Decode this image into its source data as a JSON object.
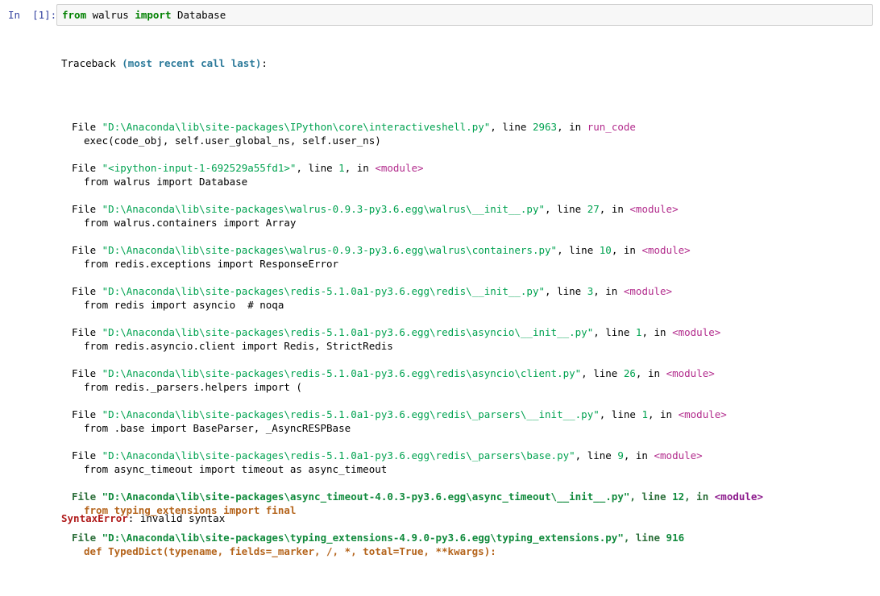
{
  "cell": {
    "prompt": "In  [1]:",
    "input": {
      "kw1": "from",
      "mod": " walrus ",
      "kw2": "import",
      "name": " Database"
    }
  },
  "traceback": {
    "header_label": "Traceback ",
    "header_paren": "(most recent call last)",
    "header_colon": ":",
    "frames": [
      {
        "file_kw": "File ",
        "path": "\"D:\\Anaconda\\lib\\site-packages\\IPython\\core\\interactiveshell.py\"",
        "line_kw": ", line ",
        "line_no": "2963",
        "in_kw": ", in ",
        "func": "run_code",
        "code": "exec(code_obj, self.user_global_ns, self.user_ns)"
      },
      {
        "file_kw": "File ",
        "path": "\"<ipython-input-1-692529a55fd1>\"",
        "line_kw": ", line ",
        "line_no": "1",
        "in_kw": ", in ",
        "func": "<module>",
        "code": "from walrus import Database"
      },
      {
        "file_kw": "File ",
        "path": "\"D:\\Anaconda\\lib\\site-packages\\walrus-0.9.3-py3.6.egg\\walrus\\__init__.py\"",
        "line_kw": ", line ",
        "line_no": "27",
        "in_kw": ", in ",
        "func": "<module>",
        "code": "from walrus.containers import Array"
      },
      {
        "file_kw": "File ",
        "path": "\"D:\\Anaconda\\lib\\site-packages\\walrus-0.9.3-py3.6.egg\\walrus\\containers.py\"",
        "line_kw": ", line ",
        "line_no": "10",
        "in_kw": ", in ",
        "func": "<module>",
        "code": "from redis.exceptions import ResponseError"
      },
      {
        "file_kw": "File ",
        "path": "\"D:\\Anaconda\\lib\\site-packages\\redis-5.1.0a1-py3.6.egg\\redis\\__init__.py\"",
        "line_kw": ", line ",
        "line_no": "3",
        "in_kw": ", in ",
        "func": "<module>",
        "code": "from redis import asyncio  # noqa"
      },
      {
        "file_kw": "File ",
        "path": "\"D:\\Anaconda\\lib\\site-packages\\redis-5.1.0a1-py3.6.egg\\redis\\asyncio\\__init__.py\"",
        "line_kw": ", line ",
        "line_no": "1",
        "in_kw": ", in ",
        "func": "<module>",
        "code": "from redis.asyncio.client import Redis, StrictRedis"
      },
      {
        "file_kw": "File ",
        "path": "\"D:\\Anaconda\\lib\\site-packages\\redis-5.1.0a1-py3.6.egg\\redis\\asyncio\\client.py\"",
        "line_kw": ", line ",
        "line_no": "26",
        "in_kw": ", in ",
        "func": "<module>",
        "code": "from redis._parsers.helpers import ("
      },
      {
        "file_kw": "File ",
        "path": "\"D:\\Anaconda\\lib\\site-packages\\redis-5.1.0a1-py3.6.egg\\redis\\_parsers\\__init__.py\"",
        "line_kw": ", line ",
        "line_no": "1",
        "in_kw": ", in ",
        "func": "<module>",
        "code": "from .base import BaseParser, _AsyncRESPBase"
      },
      {
        "file_kw": "File ",
        "path": "\"D:\\Anaconda\\lib\\site-packages\\redis-5.1.0a1-py3.6.egg\\redis\\_parsers\\base.py\"",
        "line_kw": ", line ",
        "line_no": "9",
        "in_kw": ", in ",
        "func": "<module>",
        "code": "from async_timeout import timeout as async_timeout"
      }
    ],
    "bold_frames": [
      {
        "file_kw": "File ",
        "path": "\"D:\\Anaconda\\lib\\site-packages\\async_timeout-4.0.3-py3.6.egg\\async_timeout\\__init__.py\"",
        "line_kw": ", line ",
        "line_no": "12",
        "in_kw": ", in ",
        "func": "<module>",
        "code": "from typing_extensions import final"
      },
      {
        "file_kw": "File ",
        "path": "\"D:\\Anaconda\\lib\\site-packages\\typing_extensions-4.9.0-py3.6.egg\\typing_extensions.py\"",
        "line_kw": ", line ",
        "line_no": "916",
        "in_kw": "",
        "func": "",
        "code": "def TypedDict(typename, fields=_marker, /, *, total=True, **kwargs):",
        "caret": "^"
      }
    ],
    "error_name": "SyntaxError",
    "error_sep": ": ",
    "error_msg": "invalid syntax"
  }
}
